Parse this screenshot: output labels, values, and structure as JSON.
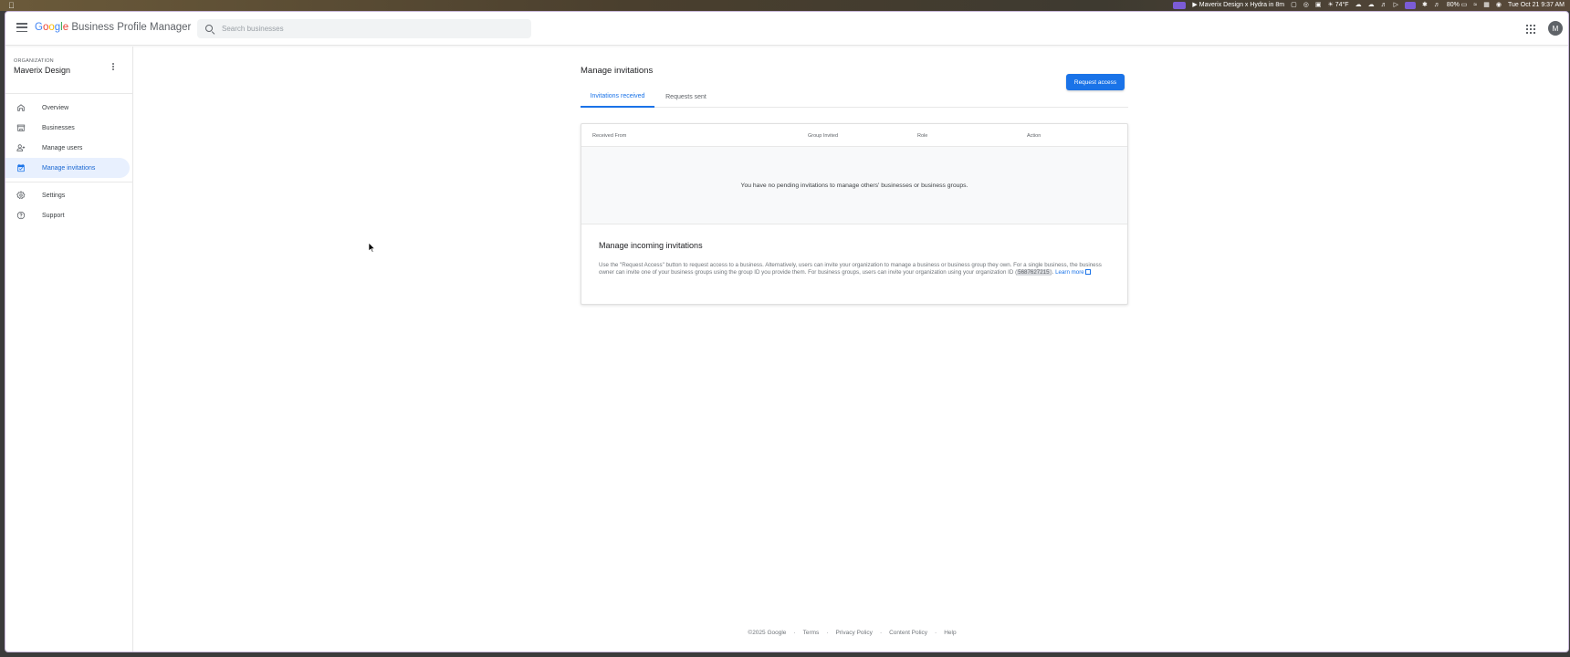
{
  "menubar": {
    "apple": "",
    "now_playing": "Maverix Design x Hydra in 8m",
    "weather": "74°F",
    "battery": "80%",
    "datetime": "Tue Oct 21  9:37 AM"
  },
  "header": {
    "brand_g": [
      "G",
      "o",
      "o",
      "g",
      "l",
      "e"
    ],
    "brand_rest": "Business Profile Manager",
    "search_placeholder": "Search businesses",
    "avatar_initial": "M"
  },
  "sidebar": {
    "org_label": "ORGANIZATION",
    "org_name": "Maverix Design",
    "items": [
      {
        "label": "Overview",
        "icon": "home-icon"
      },
      {
        "label": "Businesses",
        "icon": "storefront-icon"
      },
      {
        "label": "Manage users",
        "icon": "person-add-icon"
      },
      {
        "label": "Manage invitations",
        "icon": "calendar-check-icon",
        "active": true
      },
      {
        "label": "Settings",
        "icon": "gear-icon"
      },
      {
        "label": "Support",
        "icon": "help-icon"
      }
    ]
  },
  "main": {
    "title": "Manage invitations",
    "request_button": "Request access",
    "tabs": [
      {
        "label": "Invitations received",
        "active": true
      },
      {
        "label": "Requests sent",
        "active": false
      }
    ],
    "table": {
      "columns": [
        "Received From",
        "Group Invited",
        "Role",
        "Action"
      ],
      "empty_message": "You have no pending invitations to manage others' businesses or business groups."
    },
    "info": {
      "title": "Manage incoming invitations",
      "text_before_id": "Use the \"Request Access\" button to request access to a business. Alternatively, users can invite your organization to manage a business or business group they own. For a single business, the business owner can invite one of your business groups using the group ID you provide them. For business groups, users can invite your organization using your organization ID (",
      "org_id": "5687627215",
      "text_after_id": ").",
      "learn_more": "Learn more"
    }
  },
  "footer": {
    "copyright": "©2025 Google",
    "links": [
      "Terms",
      "Privacy Policy",
      "Content Policy",
      "Help"
    ],
    "separator": "·"
  }
}
